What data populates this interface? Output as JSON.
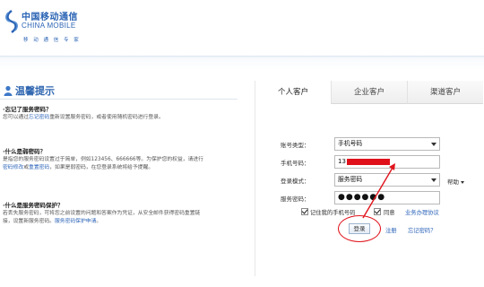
{
  "logo": {
    "cn": "中国移动通信",
    "en": "CHINA MOBILE",
    "slogan": "移 动 通 信 专 家"
  },
  "tips": {
    "title": "温馨提示",
    "items": [
      {
        "q": "·忘记了服务密码？",
        "a_pre": "您可以通过",
        "a_link": "忘记密码",
        "a_post": "重新设置服务密码，或者使用随机密码进行登录。"
      },
      {
        "q": "·什么是弱密码？",
        "a_pre": "是指您的服务密码设置过于简单，例如123456、666666等。为保护您的权益，请进行",
        "a_link": "密码修改",
        "a_mid": "或",
        "a_link2": "重置密码",
        "a_post": "，如果是弱密码，在您登录系统将给予提醒。"
      },
      {
        "q": "·什么是服务密码保护？",
        "a_pre": "若丢失服务密码，可将您之前设置的问题和答案作为凭证，从安全邮件获得密码重置链接，设置新服务密码。",
        "a_link": "服务密码保护申请",
        "a_post": "。"
      }
    ]
  },
  "login": {
    "tabs": [
      "个人客户",
      "企业客户",
      "渠道客户"
    ],
    "account_type_label": "账号类型：",
    "account_type_value": "手机号码",
    "phone_label": "手机号码：",
    "phone_value": "13",
    "login_mode_label": "登录模式：",
    "login_mode_value": "服务密码",
    "login_mode_side": "帮助",
    "password_label": "服务密码：",
    "password_value": "●●●●●●",
    "remember_label": "记住我的手机号码",
    "agree_label": "同意",
    "agreement_link": "业务办理协议",
    "login_button": "登录",
    "register_link": "注册",
    "forgot_link": "忘记密码？"
  },
  "colors": {
    "brand_blue": "#2a63b4",
    "annotation_red": "#e0141c"
  }
}
